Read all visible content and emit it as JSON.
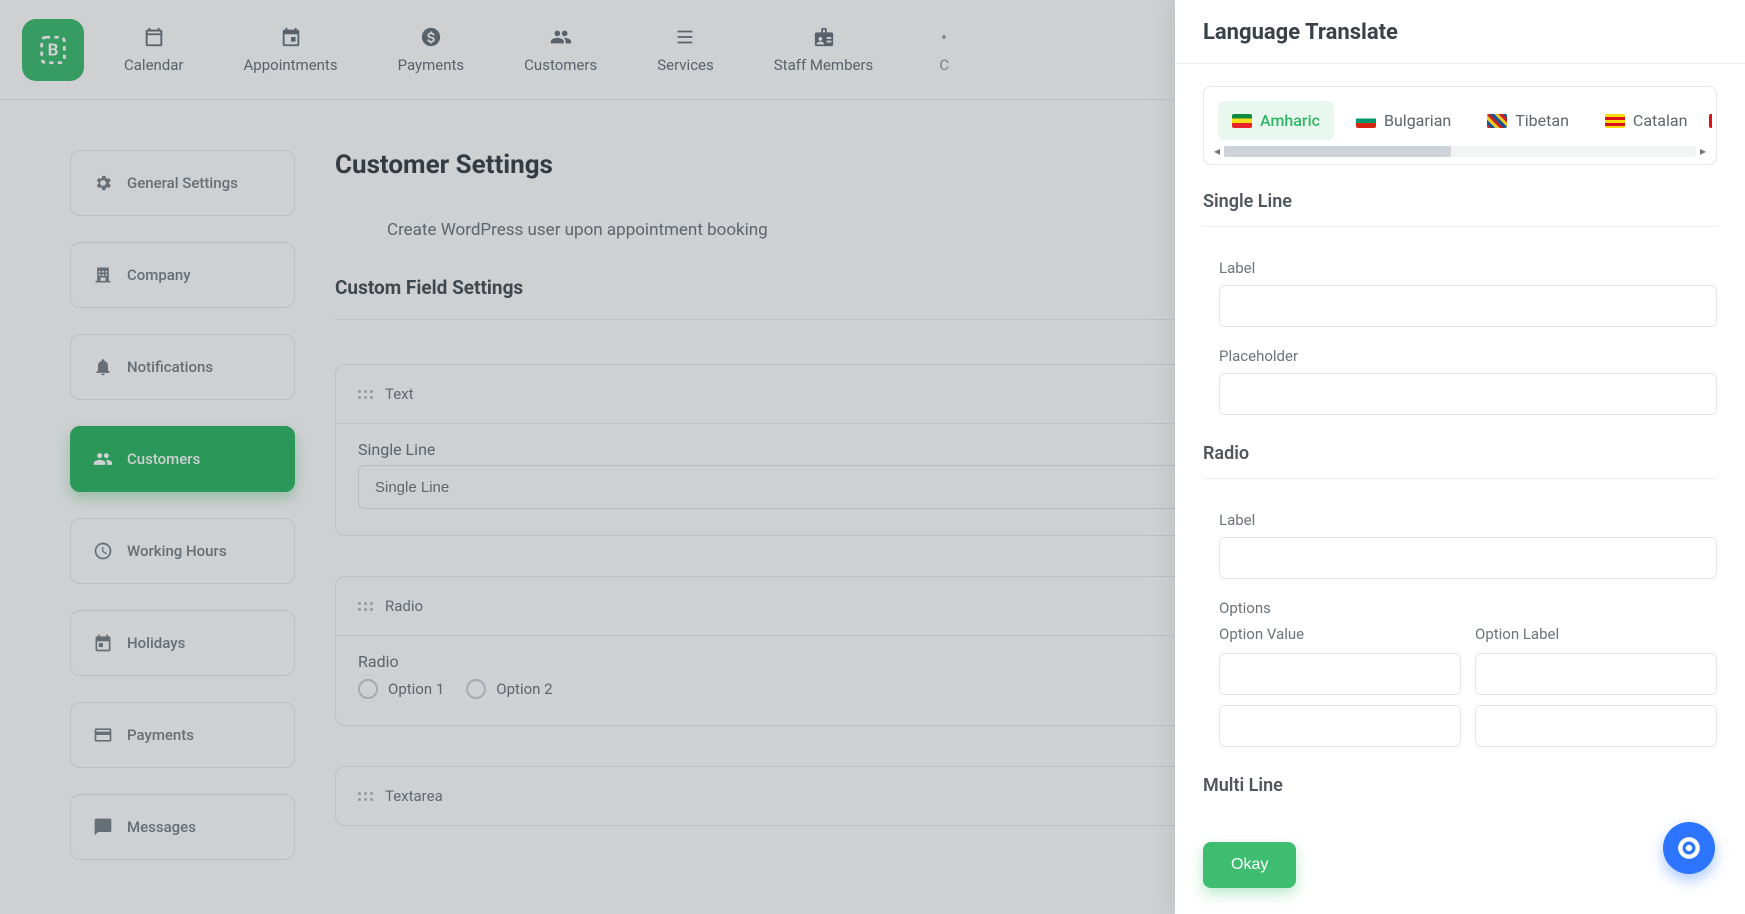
{
  "brand_color": "#3ebd70",
  "nav": [
    {
      "label": "Calendar"
    },
    {
      "label": "Appointments"
    },
    {
      "label": "Payments"
    },
    {
      "label": "Customers"
    },
    {
      "label": "Services"
    },
    {
      "label": "Staff Members"
    },
    {
      "label": "C"
    }
  ],
  "sidebar": [
    {
      "label": "General Settings"
    },
    {
      "label": "Company"
    },
    {
      "label": "Notifications"
    },
    {
      "label": "Customers"
    },
    {
      "label": "Working Hours"
    },
    {
      "label": "Holidays"
    },
    {
      "label": "Payments"
    },
    {
      "label": "Messages"
    }
  ],
  "main": {
    "page_title": "Customer Settings",
    "checkbox_label": "Create WordPress user upon appointment booking",
    "section_title": "Custom Field Settings",
    "fields": {
      "text": {
        "header": "Text",
        "label": "Single Line",
        "placeholder": "Single Line"
      },
      "radio": {
        "header": "Radio",
        "label": "Radio",
        "options": [
          "Option 1",
          "Option 2"
        ]
      },
      "textarea": {
        "header": "Textarea"
      }
    }
  },
  "drawer": {
    "title": "Language Translate",
    "languages": [
      {
        "name": "Amharic",
        "active": true
      },
      {
        "name": "Bulgarian"
      },
      {
        "name": "Tibetan"
      },
      {
        "name": "Catalan"
      }
    ],
    "sections": {
      "single_line": {
        "title": "Single Line",
        "label_field": "Label",
        "placeholder_field": "Placeholder"
      },
      "radio": {
        "title": "Radio",
        "label_field": "Label",
        "options_label": "Options",
        "option_value_label": "Option Value",
        "option_label_label": "Option Label"
      },
      "multi_line": {
        "title": "Multi Line"
      }
    },
    "okay": "Okay"
  }
}
